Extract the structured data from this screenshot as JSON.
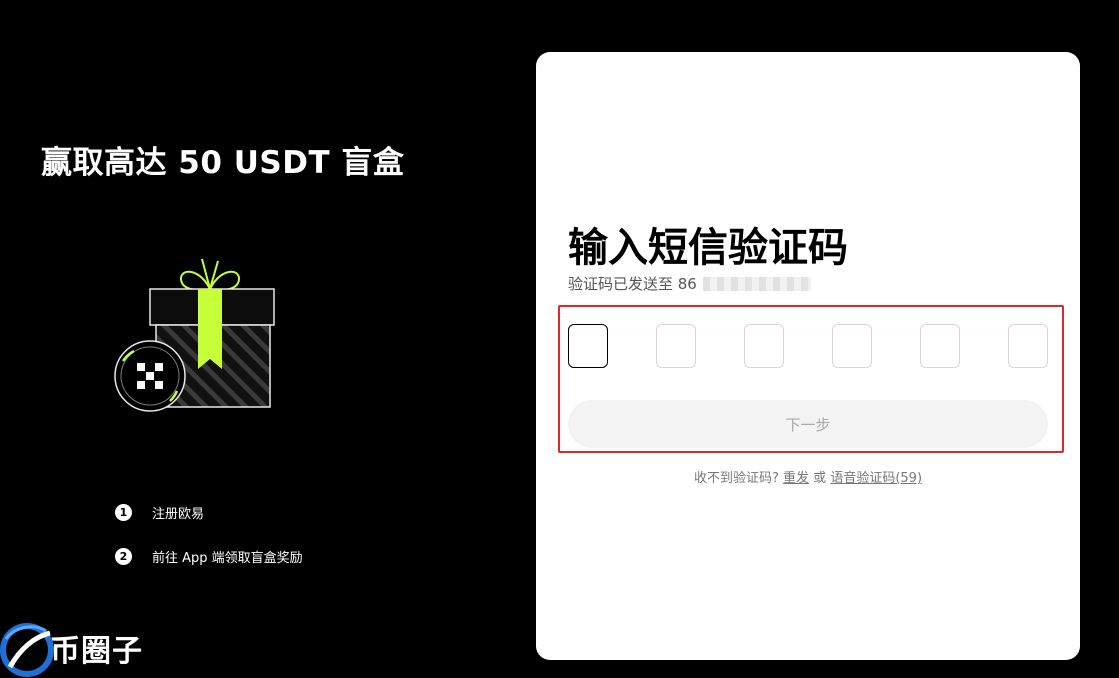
{
  "left_panel": {
    "title": "赢取高达 50 USDT 盲盒",
    "steps": [
      {
        "number": "1",
        "label": "注册欧易"
      },
      {
        "number": "2",
        "label": "前往 App 端领取盲盒奖励"
      }
    ],
    "accent_color": "#c6ff3a"
  },
  "watermark": {
    "text": "币圈子"
  },
  "card": {
    "title": "输入短信验证码",
    "subtitle_prefix": "验证码已发送至 86",
    "otp_count": 6,
    "next_button": "下一步",
    "resend": {
      "prompt": "收不到验证码?",
      "resend_link": "重发",
      "or": "或",
      "voice_link": "语音验证码(59)"
    }
  }
}
